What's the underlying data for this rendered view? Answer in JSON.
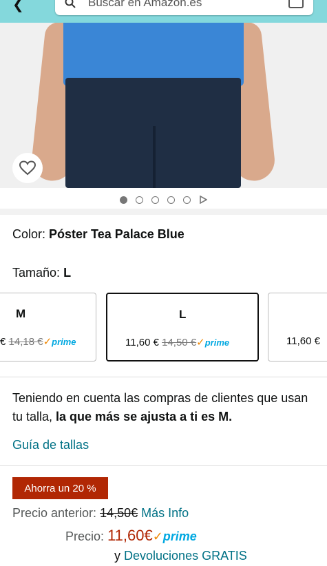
{
  "header": {
    "search_placeholder": "Buscar en Amazon.es"
  },
  "gallery": {
    "image_count": 5,
    "active_index": 0
  },
  "variations": {
    "color_label": "Color:",
    "color_value": "Póster Tea Palace Blue",
    "size_label": "Tamaño:",
    "size_value": "L",
    "options": [
      {
        "name": "M",
        "price": "",
        "old_price": "14,18 €",
        "prime": "prime",
        "price_prefix": "€"
      },
      {
        "name": "L",
        "price": "11,60 €",
        "old_price": "14,50 €",
        "prime": "prime"
      },
      {
        "name": "",
        "price": "11,60 €",
        "old_price": "",
        "prime": ""
      }
    ]
  },
  "fit": {
    "text_prefix": "Teniendo en cuenta las compras de clientes que usan tu talla, ",
    "text_bold": "la que más se ajusta a ti es M.",
    "guide_link": "Guía de tallas"
  },
  "pricing": {
    "save_badge": "Ahorra un 20 %",
    "previous_label": "Precio anterior:",
    "previous_value": "14,50€",
    "more_info": "Más Info",
    "price_label": "Precio:",
    "price_value": "11,60€",
    "prime": "prime",
    "returns_prefix": "y",
    "returns_link": "Devoluciones GRATIS"
  },
  "colors": {
    "accent_link": "#007185",
    "price_red": "#b12704",
    "prime_blue": "#00a8e1",
    "check_orange": "#f08804",
    "header_teal": "#84d8dc"
  }
}
